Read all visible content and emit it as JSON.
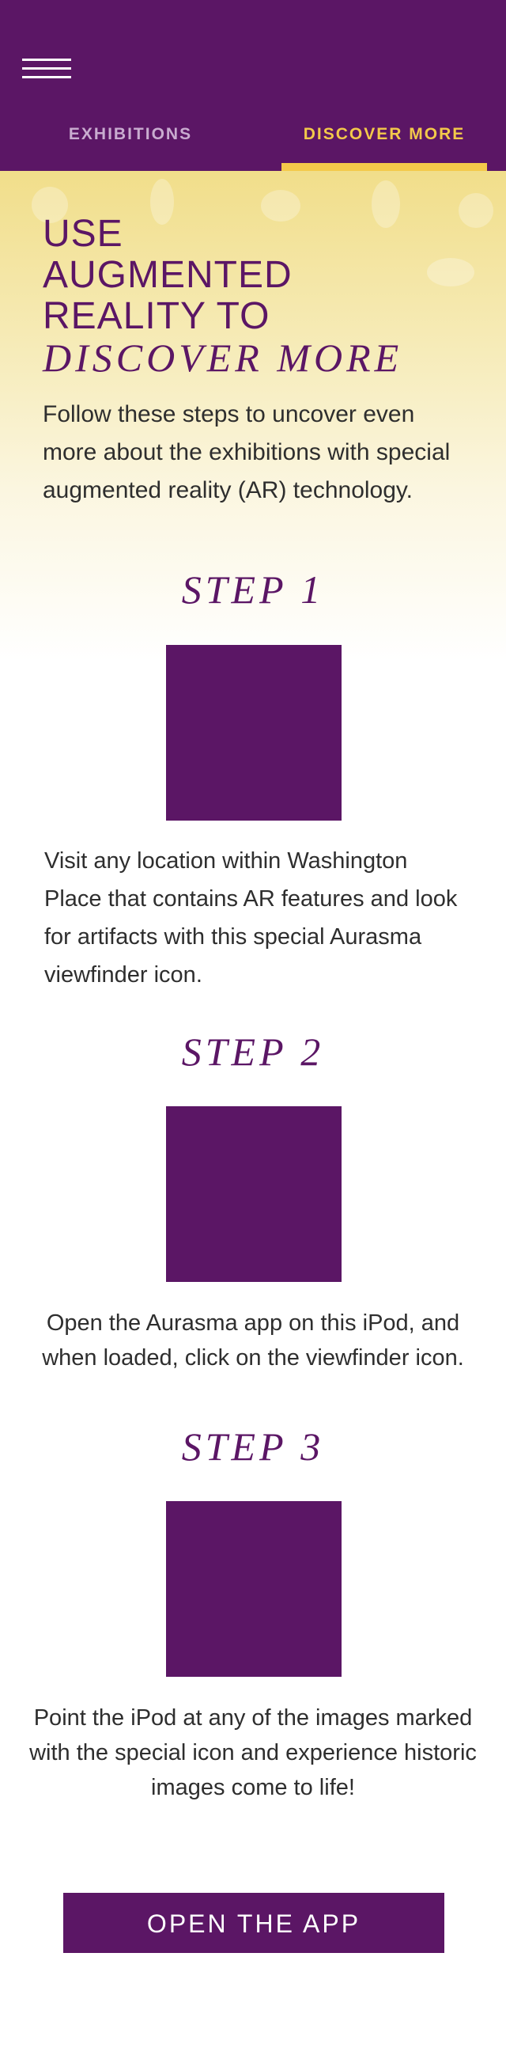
{
  "colors": {
    "brand_purple": "#5b1665",
    "accent_gold": "#f3c94a",
    "tab_inactive": "#c9acd0",
    "body_text": "#2e2e2e"
  },
  "header": {
    "menu_icon": "hamburger-menu-icon",
    "tabs": [
      {
        "label": "EXHIBITIONS",
        "active": false
      },
      {
        "label": "DISCOVER MORE",
        "active": true
      }
    ]
  },
  "hero": {
    "heading_lines": [
      "USE",
      "AUGMENTED",
      "REALITY TO"
    ],
    "heading_italic": "DISCOVER MORE",
    "intro": "Follow these steps to uncover even more about the exhibitions with special augmented reality (AR) technology."
  },
  "steps": [
    {
      "title": "STEP 1",
      "text": "Visit any location within Washington Place that contains AR features and look for artifacts with this special Aurasma viewfinder icon."
    },
    {
      "title": "STEP 2",
      "text": "Open the Aurasma app on this iPod, and when loaded, click on the viewfinder icon."
    },
    {
      "title": "STEP 3",
      "text": "Point the iPod at any of the images marked with the special icon and experience historic images come to life!"
    }
  ],
  "cta": {
    "label": "OPEN THE APP"
  }
}
